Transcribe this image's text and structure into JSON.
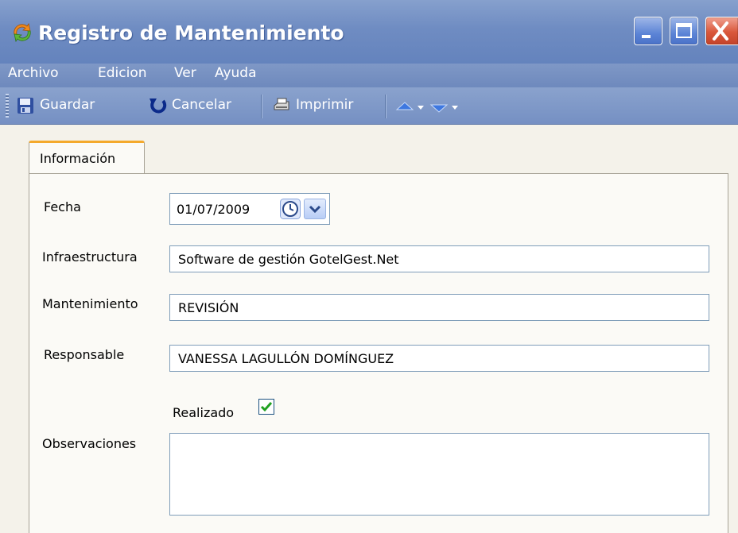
{
  "window": {
    "title": "Registro de Mantenimiento",
    "icon": "app-icon",
    "controls": [
      "minimize-icon",
      "maximize-icon",
      "close-icon"
    ]
  },
  "menu": {
    "items": [
      "Archivo",
      "Edicion",
      "Ver",
      "Ayuda"
    ]
  },
  "toolbar": {
    "save_label": "Guardar",
    "cancel_label": "Cancelar",
    "print_label": "Imprimir",
    "icons": [
      "save-icon",
      "undo-icon",
      "print-icon",
      "arrow-up-icon",
      "arrow-down-icon"
    ]
  },
  "tabs": [
    {
      "label": "Información",
      "active": true
    }
  ],
  "form": {
    "fecha_label": "Fecha",
    "fecha_value": "01/07/2009",
    "infraestructura_label": "Infraestructura",
    "infraestructura_value": "Software de gestión GotelGest.Net",
    "mantenimiento_label": "Mantenimiento",
    "mantenimiento_value": "REVISIÓN",
    "responsable_label": "Responsable",
    "responsable_value": "VANESSA LAGULLÓN DOMÍNGUEZ",
    "realizado_label": "Realizado",
    "realizado_checked": true,
    "observaciones_label": "Observaciones",
    "observaciones_value": ""
  },
  "colors": {
    "titlebar": "#6f8cc2",
    "tab_accent": "#f4a92c",
    "field_border": "#7f9db9",
    "check_mark": "#21a121"
  }
}
